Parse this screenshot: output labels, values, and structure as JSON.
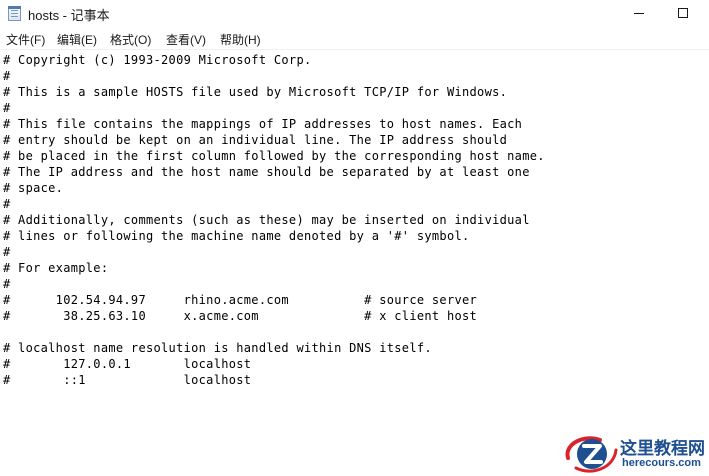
{
  "window": {
    "title": "hosts - 记事本",
    "app_icon": "notepad-icon",
    "controls": {
      "minimize": "minimize-icon",
      "maximize": "maximize-icon"
    }
  },
  "menu": [
    {
      "label": "文件(F)"
    },
    {
      "label": "编辑(E)"
    },
    {
      "label": "格式(O)"
    },
    {
      "label": "查看(V)"
    },
    {
      "label": "帮助(H)"
    }
  ],
  "editor": {
    "lines": [
      "# Copyright (c) 1993-2009 Microsoft Corp.",
      "#",
      "# This is a sample HOSTS file used by Microsoft TCP/IP for Windows.",
      "#",
      "# This file contains the mappings of IP addresses to host names. Each",
      "# entry should be kept on an individual line. The IP address should",
      "# be placed in the first column followed by the corresponding host name.",
      "# The IP address and the host name should be separated by at least one",
      "# space.",
      "#",
      "# Additionally, comments (such as these) may be inserted on individual",
      "# lines or following the machine name denoted by a '#' symbol.",
      "#",
      "# For example:",
      "#",
      "#      102.54.94.97     rhino.acme.com          # source server",
      "#       38.25.63.10     x.acme.com              # x client host",
      "",
      "# localhost name resolution is handled within DNS itself.",
      "#       127.0.0.1       localhost",
      "#       ::1             localhost"
    ]
  },
  "watermark": {
    "title": "这里教程网",
    "url": "herecours.com",
    "colors": {
      "primary": "#1d4f91",
      "accent": "#d9232d"
    }
  }
}
